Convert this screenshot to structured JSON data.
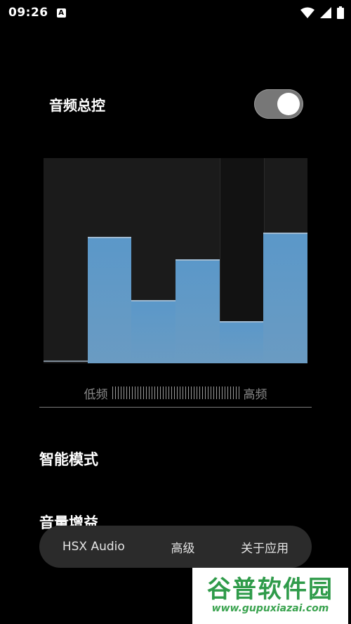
{
  "status_bar": {
    "time": "09:26",
    "notif_badge": "A"
  },
  "master": {
    "label": "音频总控",
    "enabled": true
  },
  "equalizer": {
    "selected_band": 4,
    "bands": [
      {
        "level": 0.0
      },
      {
        "level": 0.61
      },
      {
        "level": 0.3
      },
      {
        "level": 0.5
      },
      {
        "level": 0.2
      },
      {
        "level": 0.63
      }
    ]
  },
  "freq_axis": {
    "low": "低频",
    "high": "高频"
  },
  "menu": [
    {
      "label": "智能模式"
    },
    {
      "label": "音量增益"
    }
  ],
  "bottom_nav": {
    "items": [
      {
        "label": "HSX Audio"
      },
      {
        "label": "高级"
      },
      {
        "label": "关于应用"
      }
    ]
  },
  "watermark": {
    "title": "谷普软件园",
    "url": "www.gupuxiazai.com"
  },
  "colors": {
    "accent": "#5b98c9",
    "background": "#000000"
  }
}
